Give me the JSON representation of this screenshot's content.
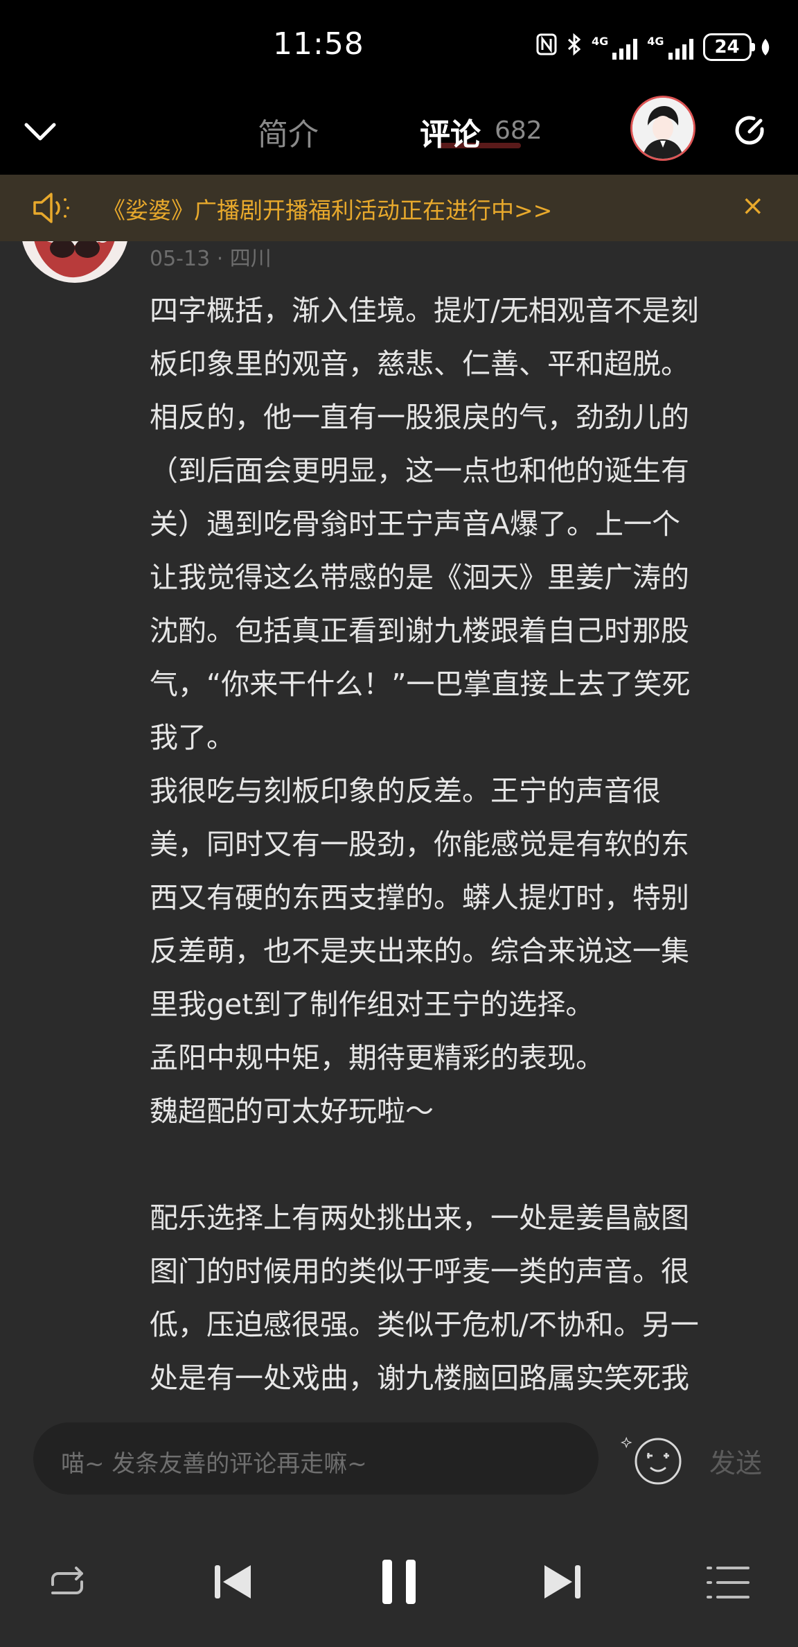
{
  "status_bar": {
    "time": "11:58",
    "network1": "4G",
    "network2": "4G",
    "battery": "24",
    "icons": [
      "nfc-icon",
      "bluetooth-icon",
      "signal-icon",
      "signal-icon",
      "battery-icon",
      "leaf-icon"
    ]
  },
  "nav": {
    "tab_intro": "简介",
    "tab_comments": "评论",
    "comment_count": "682"
  },
  "announcement": {
    "text": "《娑婆》广播剧开播福利活动正在进行中>>",
    "close": "×"
  },
  "comment": {
    "meta": "05-13 · 四川",
    "lines": [
      "四字概括，渐入佳境。提灯/无相观音不是刻",
      "板印象里的观音，慈悲、仁善、平和超脱。",
      "相反的，他一直有一股狠戾的气，劲劲儿的",
      "（到后面会更明显，这一点也和他的诞生有",
      "关）遇到吃骨翁时王宁声音A爆了。上一个",
      "让我觉得这么带感的是《洄天》里姜广涛的",
      "沈酌。包括真正看到谢九楼跟着自己时那股",
      "气，“你来干什么！”一巴掌直接上去了笑死",
      "我了。",
      "我很吃与刻板印象的反差。王宁的声音很",
      "美，同时又有一股劲，你能感觉是有软的东",
      "西又有硬的东西支撑的。蟒人提灯时，特别",
      "反差萌，也不是夹出来的。综合来说这一集",
      "里我get到了制作组对王宁的选择。",
      "孟阳中规中矩，期待更精彩的表现。",
      "魏超配的可太好玩啦～",
      "",
      "配乐选择上有两处挑出来，一处是姜昌敲图",
      "图门的时候用的类似于呼麦一类的声音。很",
      "低，压迫感很强。类似于危机/不协和。另一",
      "处是有一处戏曲，谢九楼脑回路属实笑死我"
    ]
  },
  "composer": {
    "placeholder": "喵~ 发条友善的评论再走嘛~",
    "send": "发送"
  },
  "colors": {
    "accent": "#e8a92c",
    "background": "#2b2b2b",
    "bar": "#000000"
  }
}
